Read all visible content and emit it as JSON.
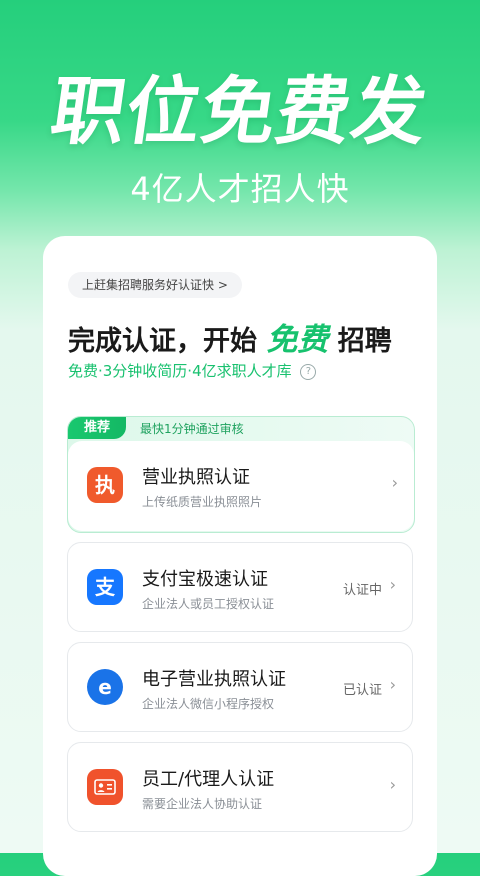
{
  "hero": {
    "title": "职位免费发",
    "subtitle": "4亿人才招人快"
  },
  "card": {
    "pill": "上赶集招聘服务好认证快 >",
    "headline_pre": "完成认证，开始 ",
    "headline_highlight": "免费",
    "headline_post": " 招聘",
    "subline": "免费·3分钟收简历·4亿求职人才库",
    "recommend_badge": "推荐",
    "recommend_text": "最快1分钟通过审核",
    "items": [
      {
        "title": "营业执照认证",
        "desc": "上传纸质营业执照照片",
        "status": "",
        "icon": "business-license-icon",
        "icon_glyph": "执",
        "color": "#f05a2c"
      },
      {
        "title": "支付宝极速认证",
        "desc": "企业法人或员工授权认证",
        "status": "认证中",
        "icon": "alipay-icon",
        "icon_glyph": "支",
        "color": "#1677ff"
      },
      {
        "title": "电子营业执照认证",
        "desc": "企业法人微信小程序授权",
        "status": "已认证",
        "icon": "e-license-icon",
        "icon_glyph": "e",
        "color": "#1a73e8"
      },
      {
        "title": "员工/代理人认证",
        "desc": "需要企业法人协助认证",
        "status": "",
        "icon": "id-card-icon",
        "icon_glyph": "",
        "color": "#f0522c"
      }
    ],
    "chevron": "›"
  }
}
